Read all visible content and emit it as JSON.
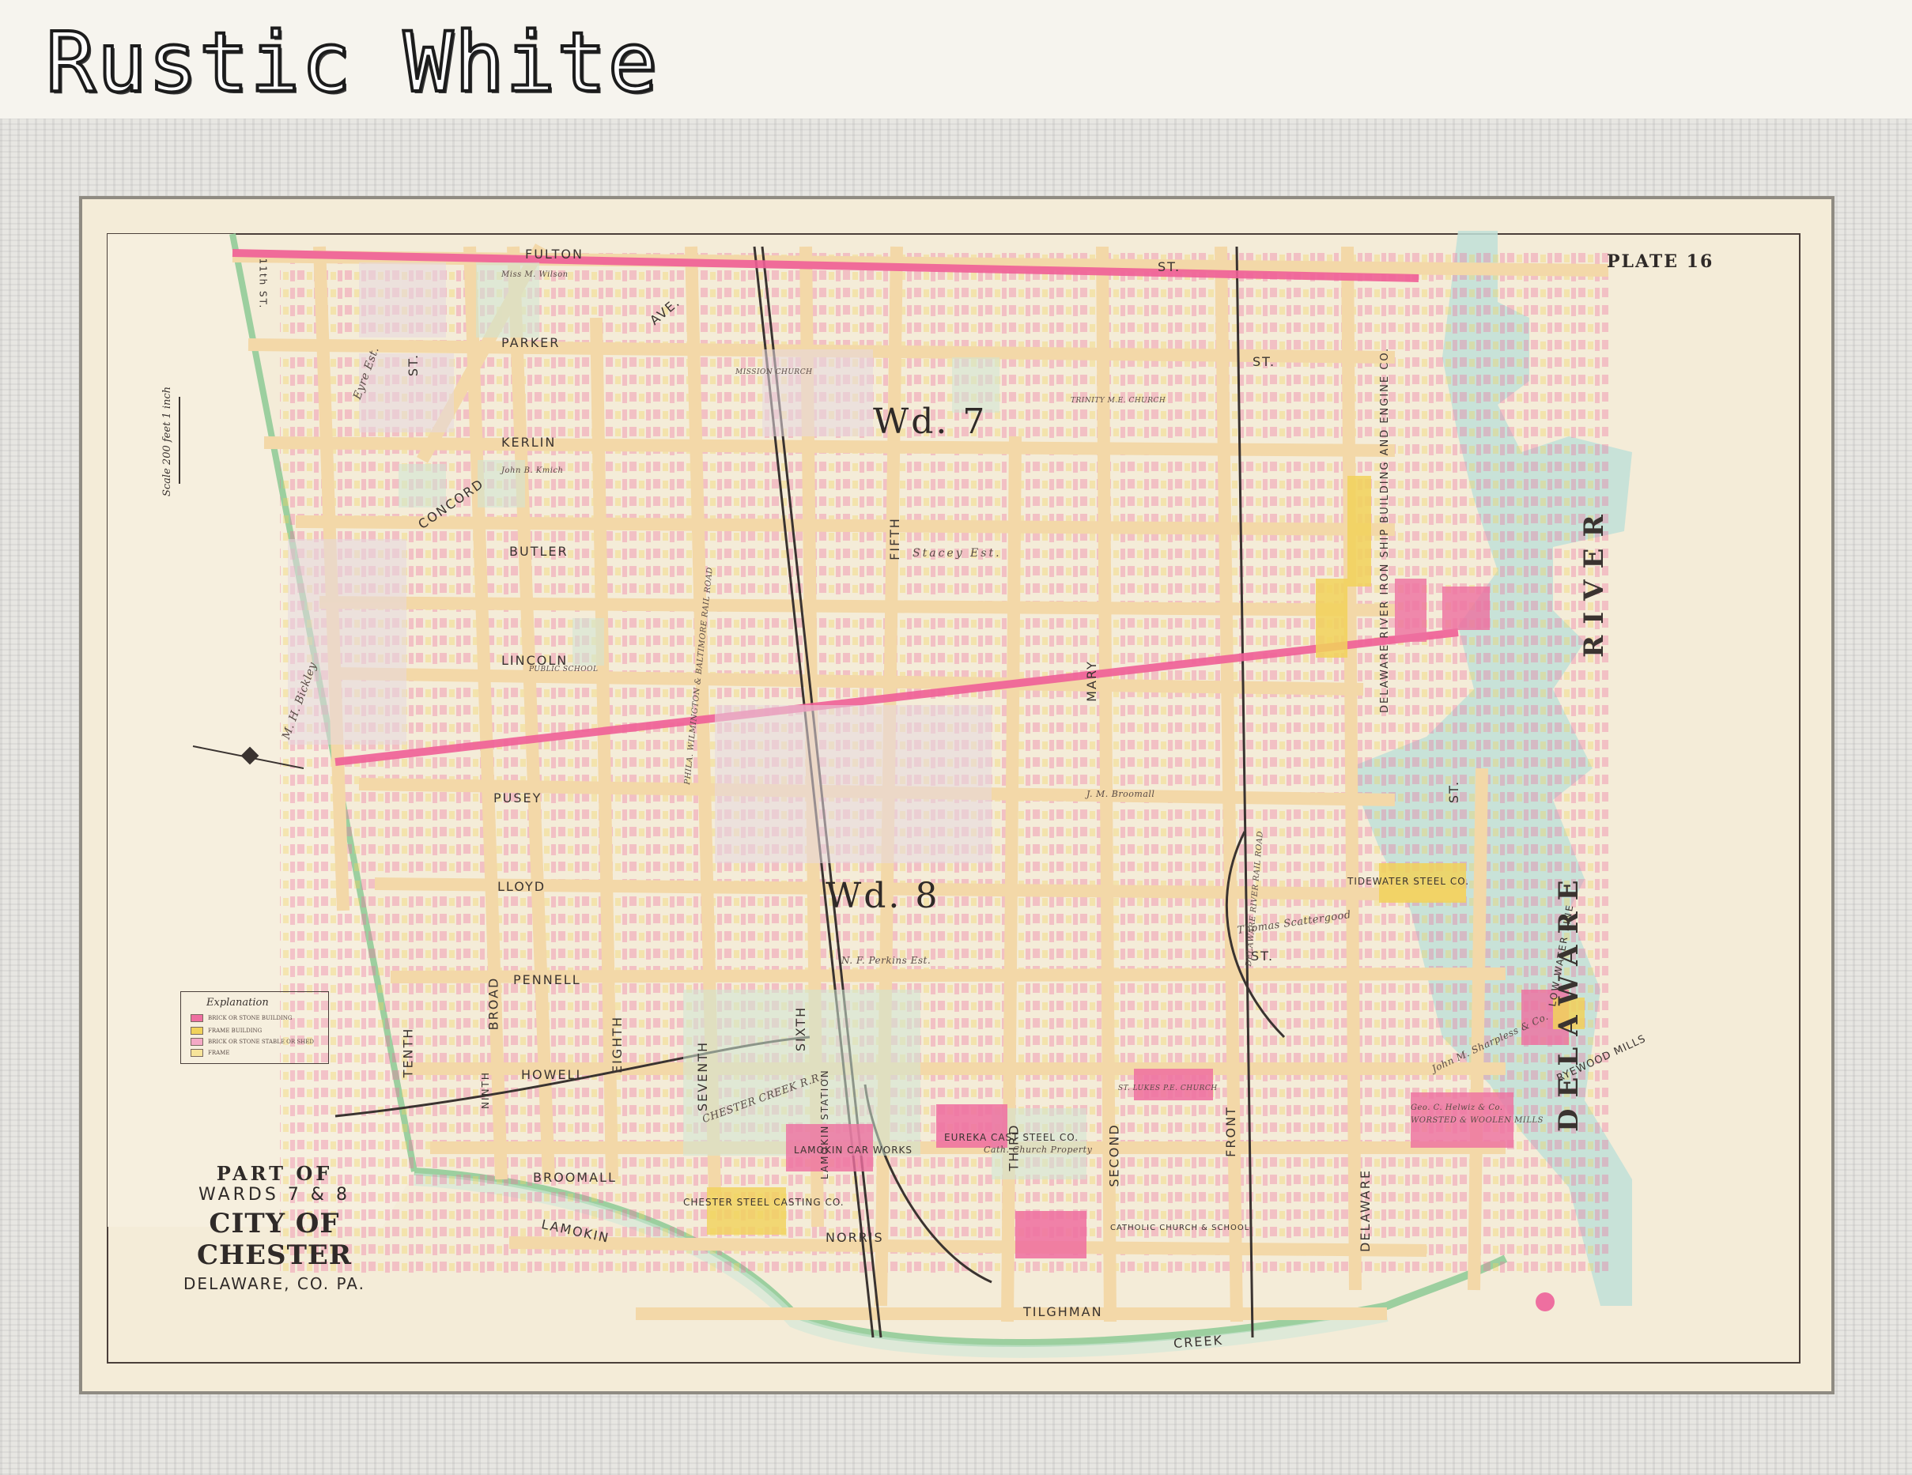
{
  "banner": {
    "title": "Rustic White"
  },
  "map": {
    "plate": "PLATE 16",
    "scale": "Scale 200 feet 1 inch",
    "wards": [
      "Wd. 7",
      "Wd. 8"
    ],
    "streets_ew": [
      "FULTON",
      "ST.",
      "PARKER",
      "KERLIN",
      "BUTLER",
      "LINCOLN",
      "PUSEY",
      "LLOYD",
      "PENNELL",
      "HOWELL",
      "BROOMALL",
      "NORRIS",
      "TILGHMAN",
      "CONCORD",
      "AVE.",
      "ST.",
      "ST."
    ],
    "streets_ns": [
      "11th ST.",
      "TENTH",
      "NINTH",
      "BROAD",
      "EIGHTH",
      "SEVENTH",
      "SIXTH",
      "FIFTH",
      "THIRD",
      "SECOND",
      "FRONT",
      "DELAWARE",
      "MARY",
      "ST.",
      "ST."
    ],
    "waterways": [
      "LAMOKIN",
      "CREEK",
      "DELAWARE",
      "RIVER"
    ],
    "railroads": [
      "PHILA. WILMINGTON & BALTIMORE RAIL ROAD",
      "LAMOKIN STATION",
      "CHESTER CREEK R.R.",
      "DELAWARE RIVER RAIL ROAD",
      "LOW WATER LINE"
    ],
    "institutions": [
      "TRINITY M.E. CHURCH",
      "PUBLIC SCHOOL",
      "MISSION CHURCH",
      "TIDEWATER STEEL CO.",
      "DELAWARE RIVER IRON SHIP BUILDING AND ENGINE CO.",
      "EUREKA CAST STEEL CO.",
      "LAMOKIN CAR WORKS",
      "CHESTER STEEL CASTING CO.",
      "CATHOLIC CHURCH & SCHOOL",
      "ST. LUKES P.E. CHURCH",
      "WORSTED & WOOLEN MILLS",
      "RYEWOOD MILLS",
      "Cath. Church Property",
      "Geo. C. Helwiz & Co.",
      "John M. Sharpless & Co."
    ],
    "owners": [
      "M. H. Bickley",
      "Eyre Est.",
      "N. F. Perkins Est.",
      "Stacey Est.",
      "Thomas Scattergood",
      "J. M. Broomall",
      "Miss M. Wilson",
      "John B. Kmich"
    ]
  },
  "legend": {
    "title": "Explanation",
    "rows": [
      {
        "label": "BRICK OR STONE BUILDING",
        "color": "#ee6fa0"
      },
      {
        "label": "FRAME BUILDING",
        "color": "#f1d25a"
      },
      {
        "label": "BRICK OR STONE STABLE OR SHED",
        "color": "#f4a9c6"
      },
      {
        "label": "FRAME",
        "color": "#f7e49a"
      }
    ]
  },
  "cartouche": {
    "part_of": "PART OF",
    "wards": "WARDS 7 & 8",
    "city": "CITY OF CHESTER",
    "county": "DELAWARE, CO. PA."
  },
  "colors": {
    "paper": "#f4ecd8",
    "street": "#f3d8a8",
    "brick": "#ee6fa0",
    "frame_bldg": "#f1d25a",
    "ward_line": "#ef5f97",
    "water": "#bfe0d8",
    "frame_wood": "#e7e6e2"
  }
}
